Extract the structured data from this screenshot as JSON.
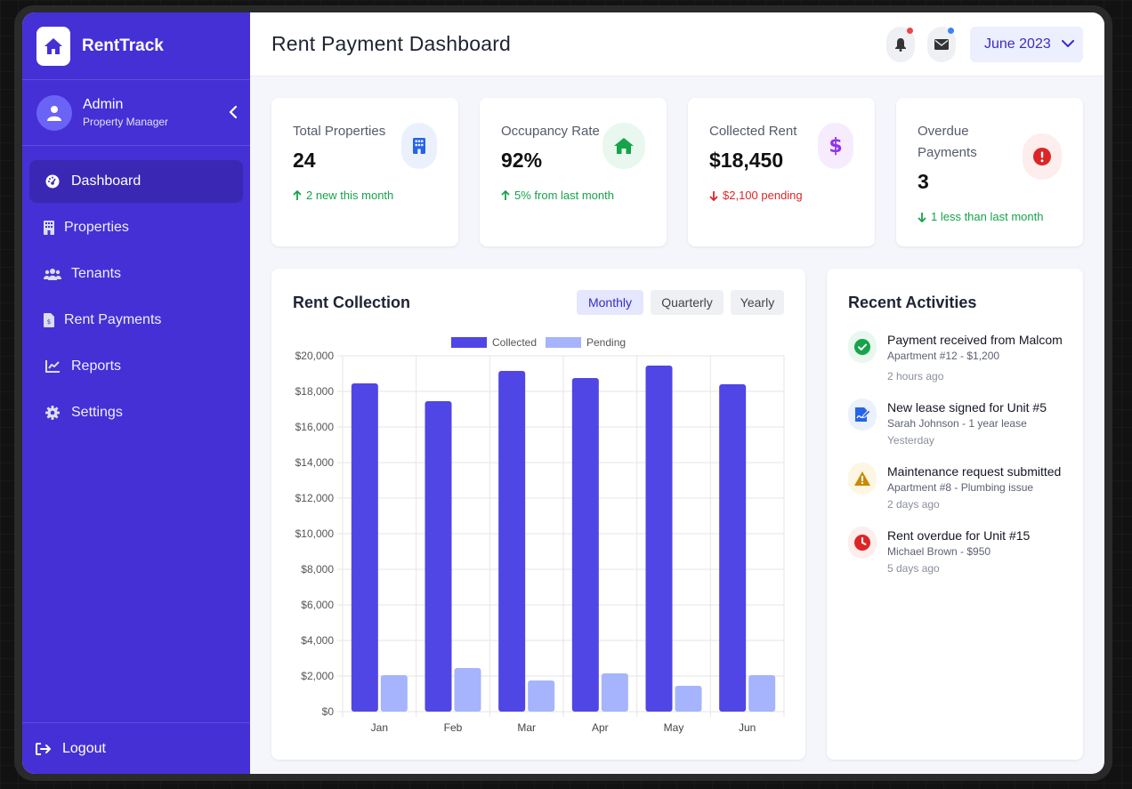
{
  "brand": {
    "name": "RentTrack"
  },
  "user": {
    "name": "Admin",
    "role": "Property Manager"
  },
  "nav": [
    {
      "label": "Dashboard",
      "icon": "gauge-icon",
      "active": true
    },
    {
      "label": "Properties",
      "icon": "building-icon"
    },
    {
      "label": "Tenants",
      "icon": "users-icon"
    },
    {
      "label": "Rent Payments",
      "icon": "invoice-icon"
    },
    {
      "label": "Reports",
      "icon": "chart-line-icon"
    },
    {
      "label": "Settings",
      "icon": "gear-icon"
    }
  ],
  "logout_label": "Logout",
  "header": {
    "title": "Rent Payment Dashboard",
    "month": "June 2023"
  },
  "stats": [
    {
      "label": "Total Properties",
      "value": "24",
      "sub": "2 new this month",
      "trend": "up",
      "color": "#16a34a",
      "icon": "building-icon"
    },
    {
      "label": "Occupancy Rate",
      "value": "92%",
      "sub": "5% from last month",
      "trend": "up",
      "color": "#16a34a",
      "icon": "home-icon"
    },
    {
      "label": "Collected Rent",
      "value": "$18,450",
      "sub": "$2,100 pending",
      "trend": "down",
      "color": "#dc2626",
      "icon": "dollar-icon"
    },
    {
      "label": "Overdue Payments",
      "value": "3",
      "sub": "1 less than last month",
      "trend": "down",
      "color": "#16a34a",
      "icon": "alert-icon"
    }
  ],
  "chart_panel": {
    "title": "Rent Collection",
    "periods": [
      "Monthly",
      "Quarterly",
      "Yearly"
    ],
    "active_period": "Monthly"
  },
  "chart_data": {
    "type": "bar",
    "categories": [
      "Jan",
      "Feb",
      "Mar",
      "Apr",
      "May",
      "Jun"
    ],
    "series": [
      {
        "name": "Collected",
        "values": [
          18450,
          17450,
          19150,
          18750,
          19450,
          18400
        ],
        "color": "#4f46e5"
      },
      {
        "name": "Pending",
        "values": [
          2050,
          2450,
          1750,
          2150,
          1450,
          2050
        ],
        "color": "#a5b4fc"
      }
    ],
    "ylim": [
      0,
      20000
    ],
    "yticks": [
      "$0",
      "$2,000",
      "$4,000",
      "$6,000",
      "$8,000",
      "$10,000",
      "$12,000",
      "$14,000",
      "$16,000",
      "$18,000",
      "$20,000"
    ],
    "grid": true,
    "legend": "top-center"
  },
  "activities_panel": {
    "title": "Recent Activities",
    "items": [
      {
        "title": "Payment received from Malcom",
        "sub": "Apartment #12 - $1,200",
        "time": "2 hours ago",
        "icon": "check-circle-icon"
      },
      {
        "title": "New lease signed for Unit #5",
        "sub": "Sarah Johnson - 1 year lease",
        "time": "Yesterday",
        "icon": "signature-icon"
      },
      {
        "title": "Maintenance request submitted",
        "sub": "Apartment #8 - Plumbing issue",
        "time": "2 days ago",
        "icon": "warning-icon"
      },
      {
        "title": "Rent overdue for Unit #15",
        "sub": "Michael Brown - $950",
        "time": "5 days ago",
        "icon": "clock-icon"
      }
    ]
  }
}
